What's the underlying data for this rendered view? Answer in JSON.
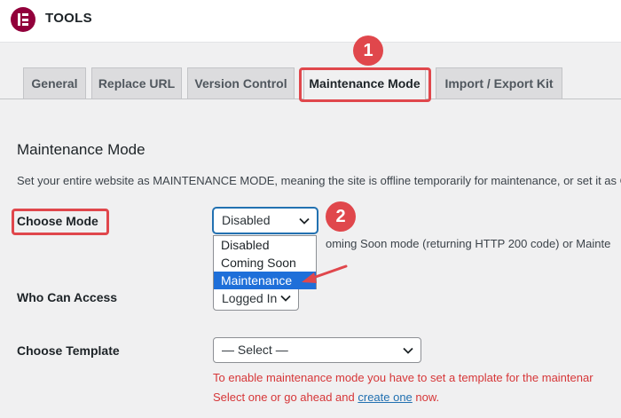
{
  "header": {
    "title": "TOOLS"
  },
  "tabs": [
    {
      "label": "General"
    },
    {
      "label": "Replace URL"
    },
    {
      "label": "Version Control"
    },
    {
      "label": "Maintenance Mode"
    },
    {
      "label": "Import / Export Kit"
    }
  ],
  "annotations": {
    "badge1": "1",
    "badge2": "2",
    "accent": "#e0474c"
  },
  "section": {
    "title": "Maintenance Mode",
    "description": "Set your entire website as MAINTENANCE MODE, meaning the site is offline temporarily for maintenance, or set it as CO"
  },
  "choose_mode": {
    "label": "Choose Mode",
    "value": "Disabled",
    "options": [
      "Disabled",
      "Coming Soon",
      "Maintenance"
    ],
    "highlighted": "Maintenance",
    "note": "oming Soon mode (returning HTTP 200 code) or Mainte"
  },
  "who_can_access": {
    "label": "Who Can Access",
    "value": "Logged In"
  },
  "choose_template": {
    "label": "Choose Template",
    "value": "— Select —",
    "warning_line1": "To enable maintenance mode you have to set a template for the maintenar",
    "warning_line2_prefix": "Select one or go ahead and ",
    "warning_link": "create one",
    "warning_line2_suffix": " now."
  }
}
